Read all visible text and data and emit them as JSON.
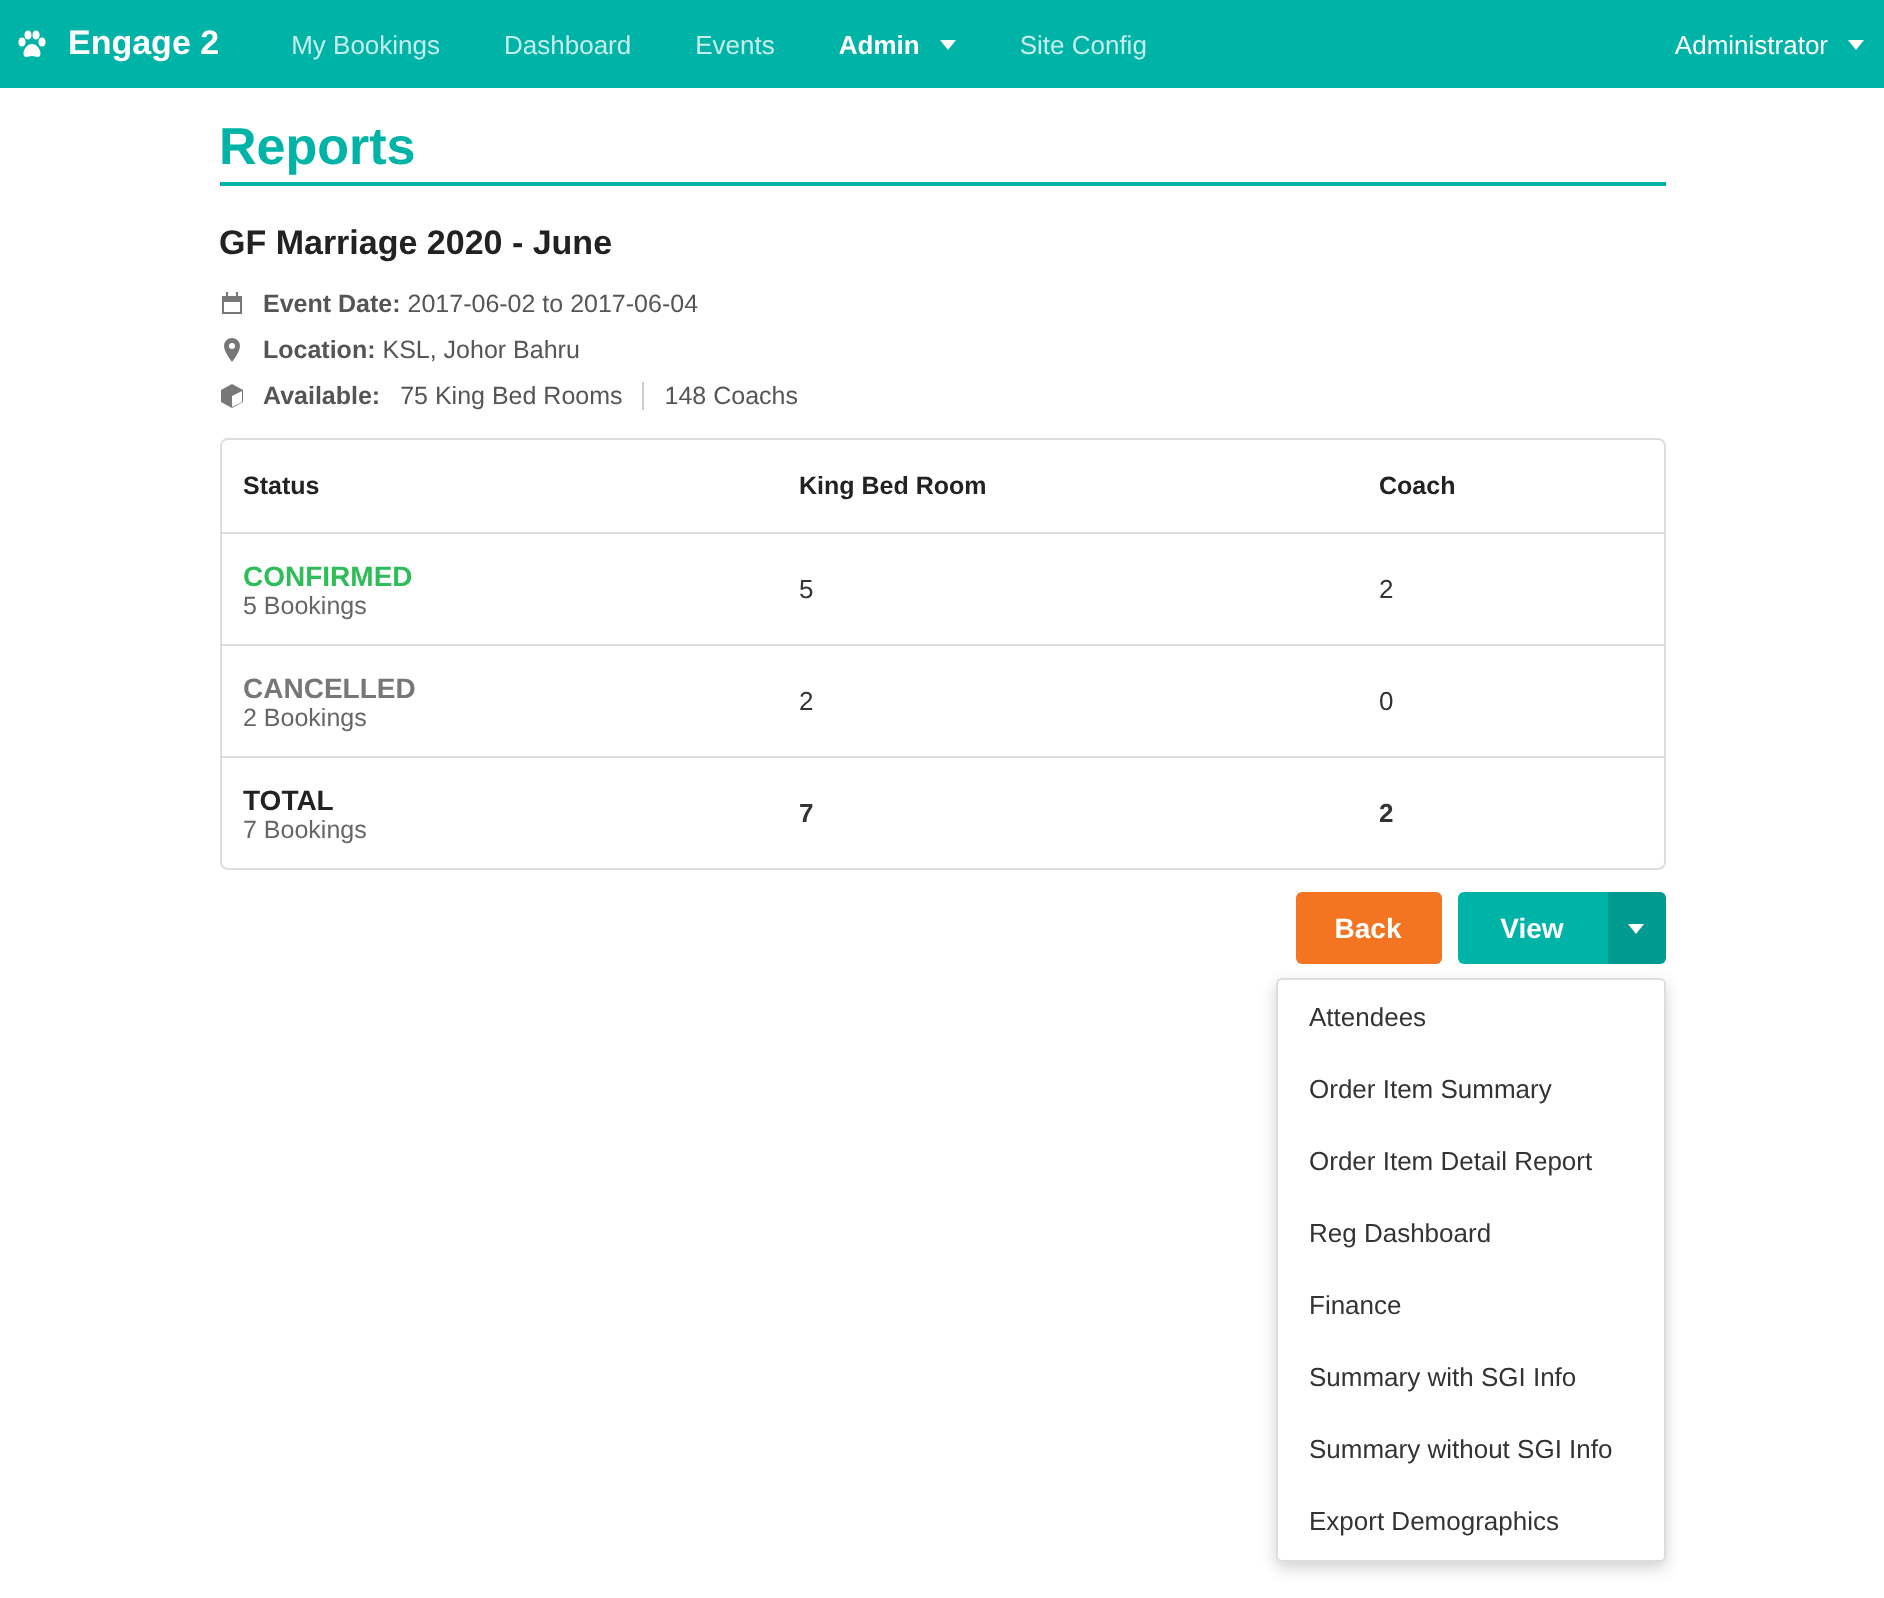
{
  "navbar": {
    "brand": "Engage 2",
    "items": [
      {
        "label": "My Bookings",
        "selected": false,
        "dropdown": false
      },
      {
        "label": "Dashboard",
        "selected": false,
        "dropdown": false
      },
      {
        "label": "Events",
        "selected": false,
        "dropdown": false
      },
      {
        "label": "Admin",
        "selected": true,
        "dropdown": true
      },
      {
        "label": "Site Config",
        "selected": false,
        "dropdown": false
      }
    ],
    "user": "Administrator"
  },
  "page_title": "Reports",
  "event": {
    "name": "GF Marriage 2020 - June",
    "date_label": "Event Date:",
    "date": "2017-06-02 to 2017-06-04",
    "location_label": "Location:",
    "location": "KSL, Johor Bahru",
    "available_label": "Available:",
    "available": [
      "75 King Bed Rooms",
      "148 Coachs"
    ]
  },
  "table": {
    "columns": [
      "Status",
      "King Bed Room",
      "Coach"
    ],
    "rows": [
      {
        "kind": "confirmed",
        "cells": [
          {
            "status": "CONFIRMED",
            "bookings": "5 Bookings"
          },
          "5",
          "2"
        ]
      },
      {
        "kind": "cancelled",
        "cells": [
          {
            "status": "CANCELLED",
            "bookings": "2 Bookings"
          },
          "2",
          "0"
        ]
      },
      {
        "kind": "total",
        "cells": [
          {
            "status": "TOTAL",
            "bookings": "7 Bookings"
          },
          "7",
          "2"
        ]
      }
    ]
  },
  "buttons": {
    "back": "Back",
    "view": "View"
  },
  "view_menu": {
    "expanded": true,
    "items": [
      "Attendees",
      "Order Item Summary",
      "Order Item Detail Report",
      "Reg Dashboard",
      "Finance",
      "Summary with SGI Info",
      "Summary without SGI Info",
      "Export Demographics"
    ]
  }
}
